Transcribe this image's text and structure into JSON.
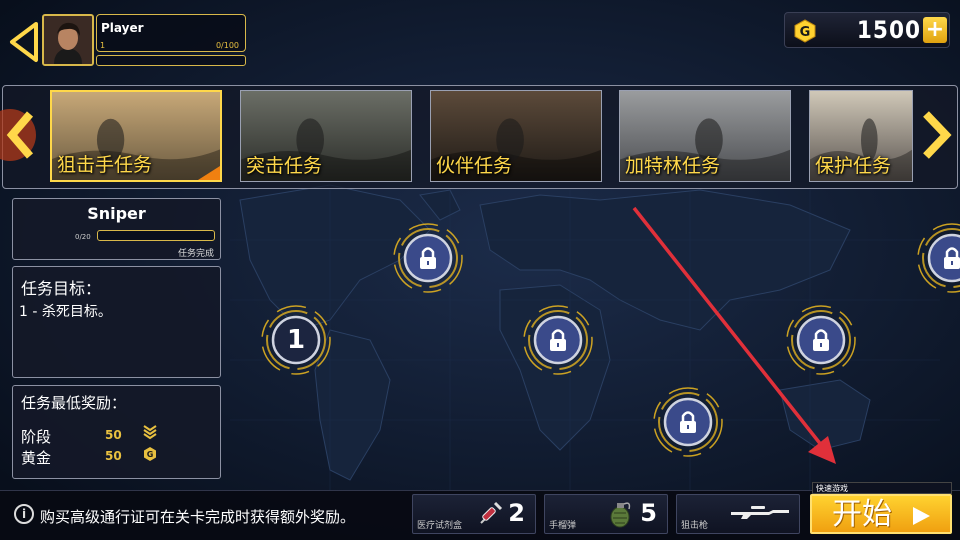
{
  "player": {
    "name": "Player",
    "level": "1",
    "xp": "0/100"
  },
  "currency": {
    "amount": "1500",
    "icon_letter": "G",
    "plus": "+"
  },
  "missions": [
    {
      "label": "狙击手任务",
      "selected": true
    },
    {
      "label": "突击任务",
      "selected": false
    },
    {
      "label": "伙伴任务",
      "selected": false
    },
    {
      "label": "加特林任务",
      "selected": false
    },
    {
      "label": "保护任务",
      "selected": false
    }
  ],
  "mission_info": {
    "title": "Sniper",
    "progress": "0/20",
    "progress_fraction": 0,
    "complete_label": "任务完成"
  },
  "objective": {
    "title": "任务目标：",
    "text": "1 - 杀死目标。"
  },
  "rewards": {
    "title": "任务最低奖励：",
    "rows": [
      {
        "label": "阶段",
        "value": "50",
        "icon": "rank-chevron-icon"
      },
      {
        "label": "黄金",
        "value": "50",
        "icon": "gold-coin-icon"
      }
    ]
  },
  "map_nodes": [
    {
      "label": "1",
      "locked": false
    },
    {
      "label": "",
      "locked": true
    },
    {
      "label": "",
      "locked": true
    },
    {
      "label": "",
      "locked": true
    },
    {
      "label": "",
      "locked": true
    },
    {
      "label": "",
      "locked": true
    }
  ],
  "bottom": {
    "info_icon": "i",
    "info_text": "购买高级通行证可在关卡完成时获得额外奖励。",
    "items": [
      {
        "label": "医疗试剂盒",
        "count": "2",
        "icon": "syringe-icon"
      },
      {
        "label": "手榴弹",
        "count": "5",
        "icon": "grenade-icon"
      },
      {
        "label": "狙击枪",
        "count": "",
        "icon": "sniper-rifle-icon"
      }
    ],
    "quick_label": "快速游戏",
    "start_label": "开始"
  },
  "colors": {
    "accent": "#ffd84a",
    "background": "#0c1526",
    "annotation": "#e0303a"
  }
}
